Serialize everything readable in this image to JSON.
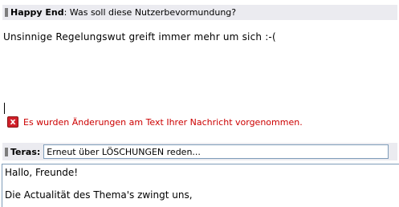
{
  "header": {
    "author": "Happy End",
    "subject": ": Was soll diese Nutzerbevormundung?"
  },
  "message": {
    "body_line": "Unsinnige Regelungswut greift immer mehr um sich :-("
  },
  "error": {
    "icon": "close-icon",
    "icon_glyph": "x",
    "text": "Es wurden Änderungen am Text Ihrer Nachricht vorgenommen."
  },
  "reply": {
    "author_label": "Teras:",
    "subject_value": "Erneut über LÖSCHUNGEN reden...",
    "body_lines": [
      "Hallo, Freunde!",
      "Die Actualität des Thema's zwingt uns,"
    ]
  },
  "colors": {
    "header_bg": "#ebebf0",
    "error_text": "#cc0000",
    "error_icon": "#d0202a",
    "input_border": "#7f9db9"
  }
}
